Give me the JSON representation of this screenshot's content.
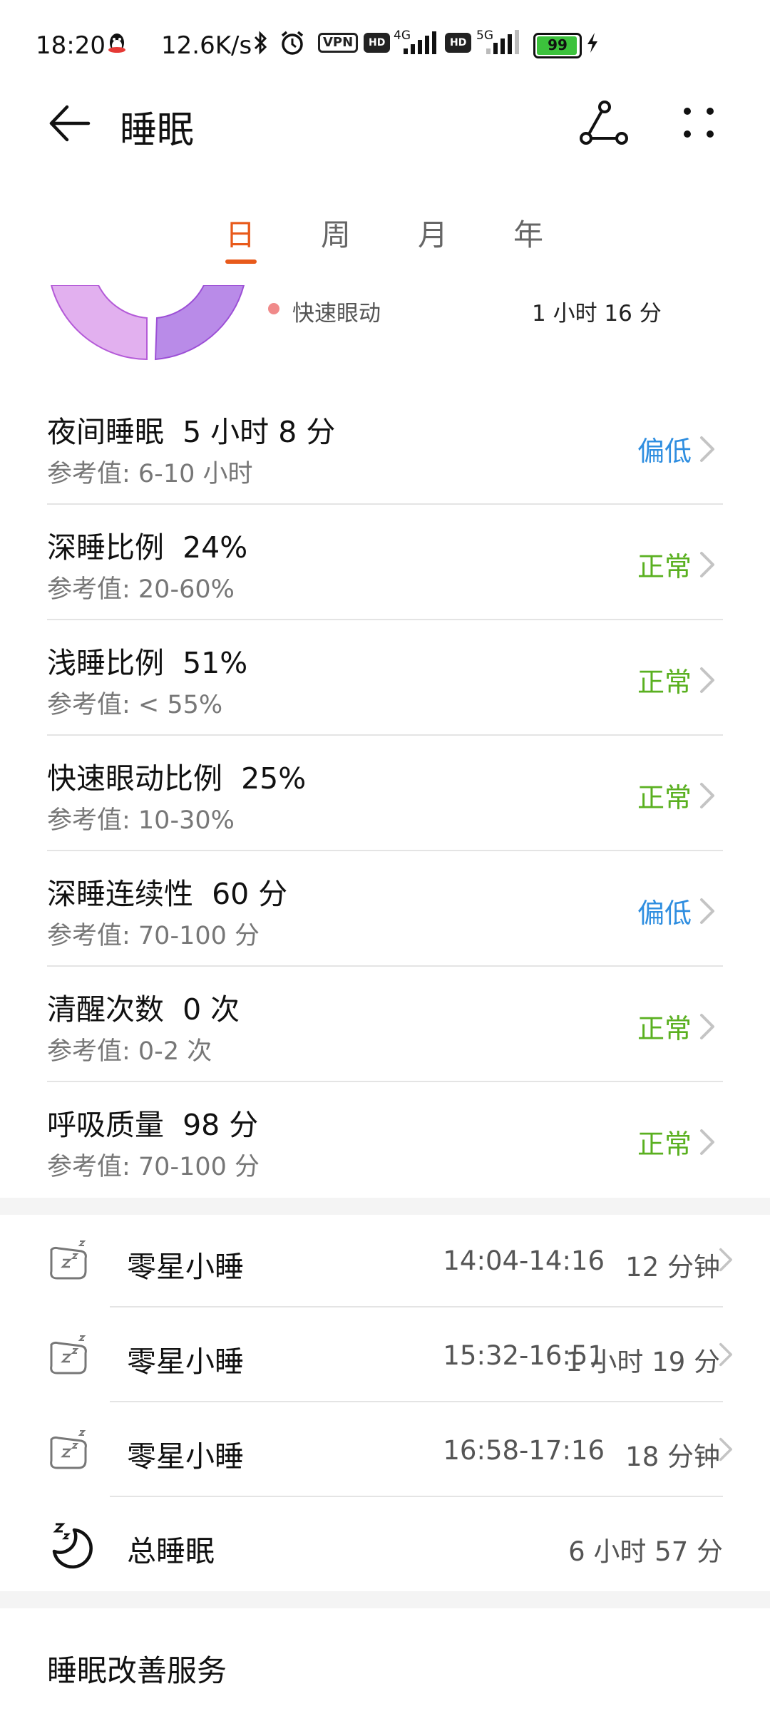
{
  "status_bar": {
    "time": "18:20",
    "speed": "12.6K/s",
    "vpn": "VPN",
    "hd1": "HD",
    "net1": "4G",
    "hd2": "HD",
    "net2": "5G",
    "battery": "99"
  },
  "header": {
    "title": "睡眠"
  },
  "tabs": [
    {
      "label": "日",
      "active": true
    },
    {
      "label": "周",
      "active": false
    },
    {
      "label": "月",
      "active": false
    },
    {
      "label": "年",
      "active": false
    }
  ],
  "legend": {
    "label": "快速眼动",
    "value": "1 小时 16 分"
  },
  "metrics": [
    {
      "name": "夜间睡眠  5 小时 8 分",
      "ref": "参考值: 6-10 小时",
      "status": "偏低",
      "level": "low"
    },
    {
      "name": "深睡比例  24%",
      "ref": "参考值: 20-60%",
      "status": "正常",
      "level": "ok"
    },
    {
      "name": "浅睡比例  51%",
      "ref": "参考值: < 55%",
      "status": "正常",
      "level": "ok"
    },
    {
      "name": "快速眼动比例  25%",
      "ref": "参考值: 10-30%",
      "status": "正常",
      "level": "ok"
    },
    {
      "name": "深睡连续性  60 分",
      "ref": "参考值: 70-100 分",
      "status": "偏低",
      "level": "low"
    },
    {
      "name": "清醒次数  0 次",
      "ref": "参考值: 0-2 次",
      "status": "正常",
      "level": "ok"
    },
    {
      "name": "呼吸质量  98 分",
      "ref": "参考值: 70-100 分",
      "status": "正常",
      "level": "ok"
    }
  ],
  "naps": [
    {
      "label": "零星小睡",
      "time_range": "14:04-14:16",
      "duration": "12 分钟"
    },
    {
      "label": "零星小睡",
      "time_range": "15:32-16:51",
      "duration": "1 小时 19 分"
    },
    {
      "label": "零星小睡",
      "time_range": "16:58-17:16",
      "duration": "18 分钟"
    }
  ],
  "total": {
    "label": "总睡眠",
    "duration": "6 小时 57 分"
  },
  "section": {
    "title": "睡眠改善服务"
  },
  "colors": {
    "accent": "#e85a1b",
    "low": "#2f8ee0",
    "ok": "#5ab020",
    "rem": "#f08a8a",
    "light_purple": "#e2b0ef",
    "purple": "#b98be8"
  }
}
